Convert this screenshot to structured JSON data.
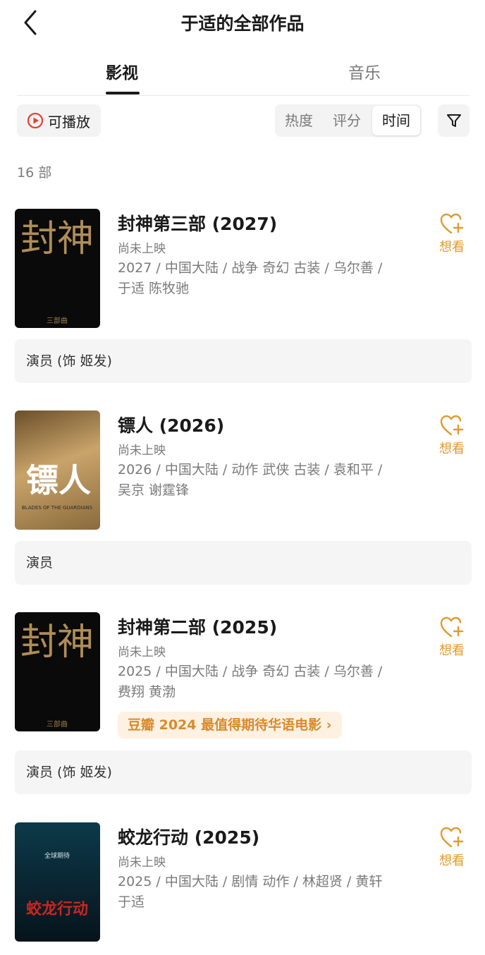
{
  "header": {
    "title": "于适的全部作品"
  },
  "tabs": [
    {
      "label": "影视"
    },
    {
      "label": "音乐"
    }
  ],
  "filters": {
    "playable_label": "可播放",
    "sort_options": [
      {
        "label": "热度"
      },
      {
        "label": "评分"
      },
      {
        "label": "时间"
      }
    ],
    "selected_sort": "时间"
  },
  "count_text": "16 部",
  "colors": {
    "accent_orange": "#e09b2d",
    "play_red": "#e34234"
  },
  "movies": [
    {
      "title": "封神第三部 (2027)",
      "status": "尚未上映",
      "meta_line1": "2027 / 中国大陆 / 战争 奇幻 古装 / 乌尔善 /",
      "meta_line2": "于适 陈牧驰",
      "want_label": "想看",
      "role": "演员 (饰 姬发)",
      "poster_text": "封神",
      "poster_sub": "三部曲"
    },
    {
      "title": "镖人 (2026)",
      "status": "尚未上映",
      "meta_line1": "2026 / 中国大陆 / 动作 武侠 古装 / 袁和平 /",
      "meta_line2": "吴京 谢霆锋",
      "want_label": "想看",
      "role": "演员",
      "poster_text": "镖人",
      "poster_sub": "BLADES OF THE GUARDIANS"
    },
    {
      "title": "封神第二部 (2025)",
      "status": "尚未上映",
      "meta_line1": "2025 / 中国大陆 / 战争 奇幻 古装 / 乌尔善 /",
      "meta_line2": "费翔 黄渤",
      "award": "豆瓣 2024 最值得期待华语电影 ›",
      "want_label": "想看",
      "role": "演员 (饰 姬发)",
      "poster_text": "封神",
      "poster_sub": "三部曲"
    },
    {
      "title": "蛟龙行动 (2025)",
      "status": "尚未上映",
      "meta_line1": "2025 / 中国大陆 / 剧情 动作 / 林超贤 / 黄轩",
      "meta_line2": "于适",
      "want_label": "想看",
      "poster_text": "蛟龙行动",
      "poster_sub": "全球期待"
    }
  ]
}
